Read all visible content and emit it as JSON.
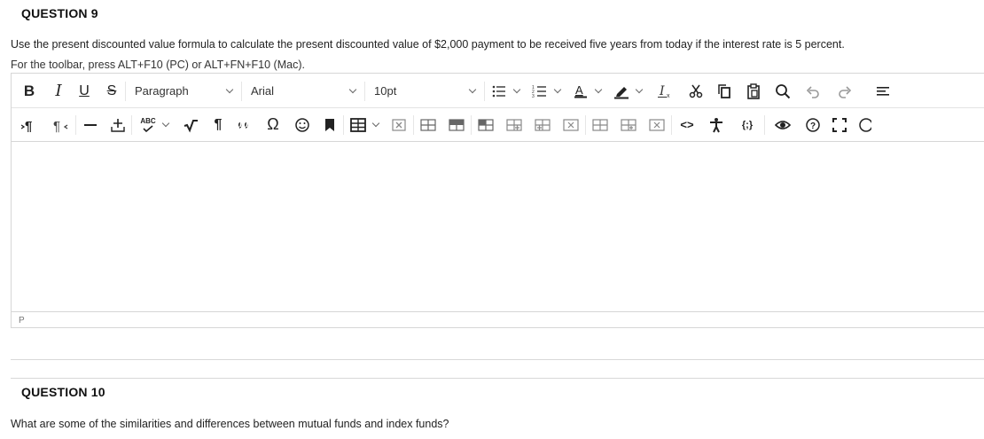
{
  "q9": {
    "title": "QUESTION 9",
    "text": "Use the present discounted value formula to calculate the present discounted value of $2,000 payment to be received five years from today if the interest rate is 5 percent.",
    "toolbar_help": "For the toolbar, press ALT+F10 (PC) or ALT+FN+F10 (Mac)."
  },
  "toolbar": {
    "bold": "B",
    "italic": "I",
    "underline": "U",
    "strike": "S",
    "block_format": "Paragraph",
    "font_family": "Arial",
    "font_size": "10pt",
    "spellcheck_label": "ABC",
    "omega": "Ω",
    "pilcrow": "¶",
    "code": "<>",
    "source": "{;}"
  },
  "editor": {
    "body_text": "",
    "status_path": "P"
  },
  "q10": {
    "title": "QUESTION 10",
    "text": "What are some of the similarities and differences between mutual funds and index funds?"
  }
}
